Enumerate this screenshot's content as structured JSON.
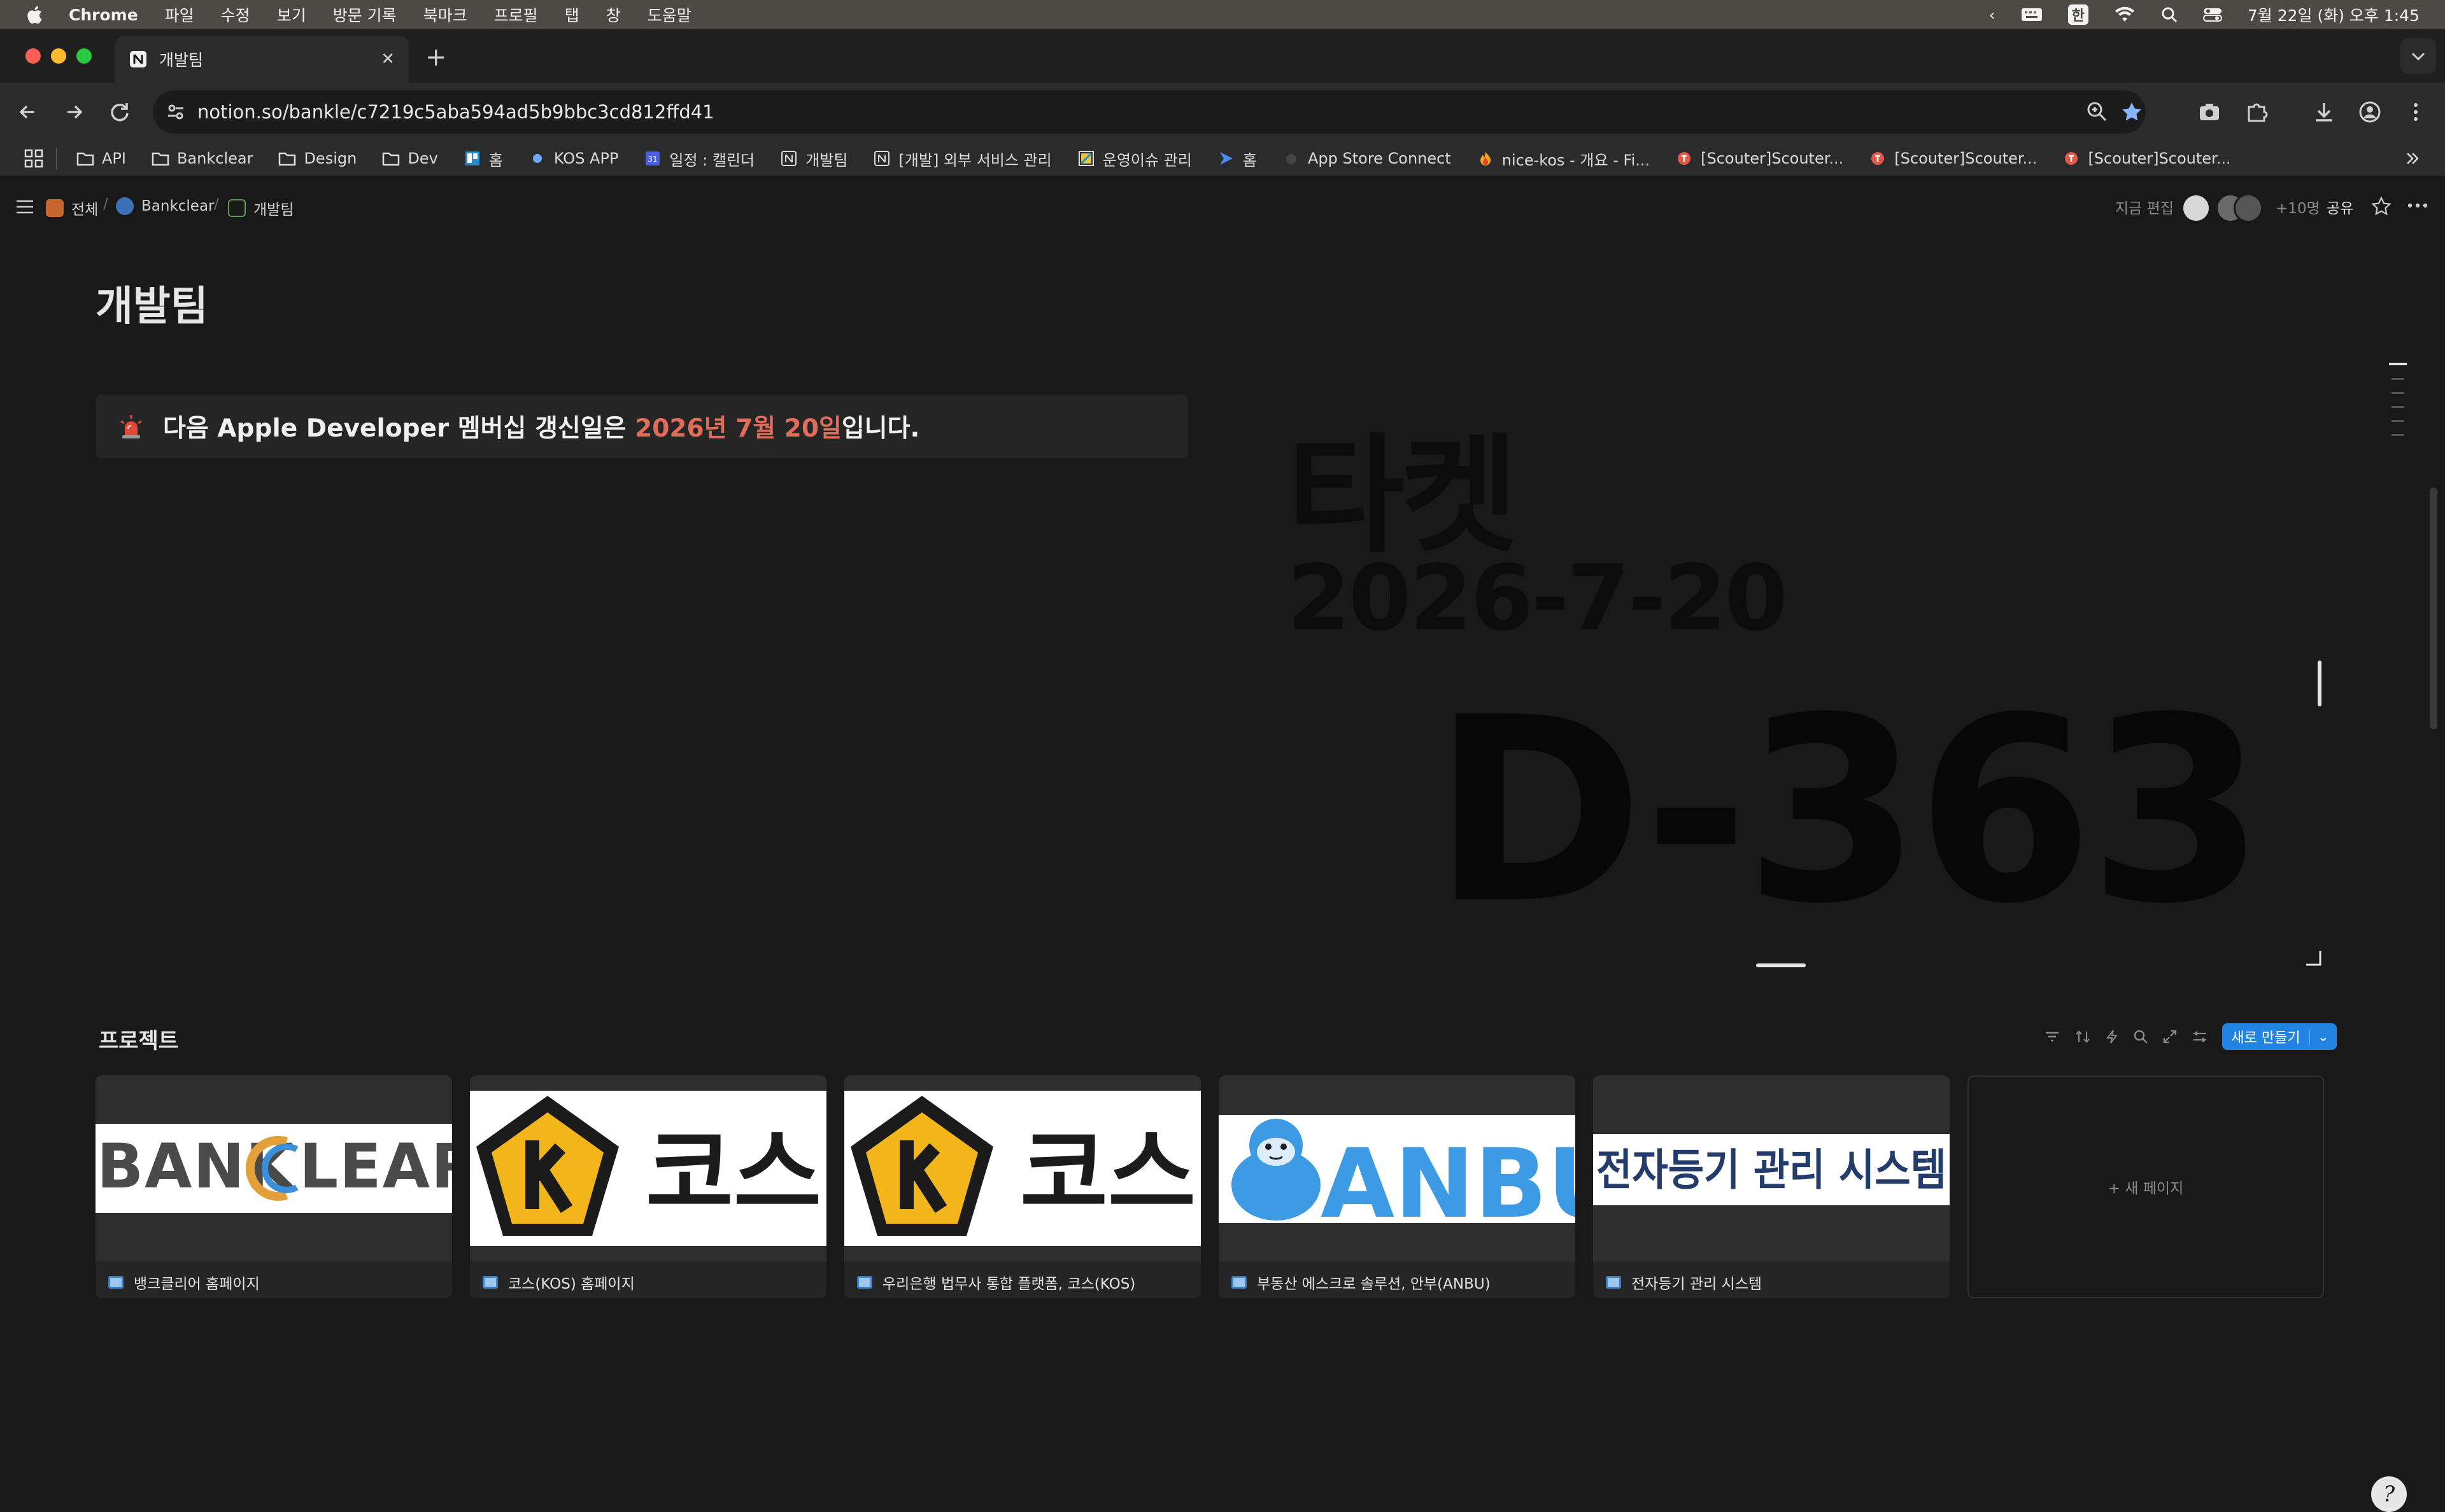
{
  "menubar": {
    "app": "Chrome",
    "items": [
      "파일",
      "수정",
      "보기",
      "방문 기록",
      "북마크",
      "프로필",
      "탭",
      "창",
      "도움말"
    ],
    "ime": "한",
    "clock": "7월 22일 (화) 오후 1:45"
  },
  "tab": {
    "title": "개발팀"
  },
  "omnibox": {
    "url": "notion.so/bankle/c7219c5aba594ad5b9bbc3cd812ffd41"
  },
  "bookmarks": [
    {
      "label": "API",
      "icon": "folder-icon"
    },
    {
      "label": "Bankclear",
      "icon": "folder-icon"
    },
    {
      "label": "Design",
      "icon": "folder-icon"
    },
    {
      "label": "Dev",
      "icon": "folder-icon"
    },
    {
      "label": "홈",
      "icon": "board-icon"
    },
    {
      "label": "KOS APP",
      "icon": "circle-icon"
    },
    {
      "label": "일정 : 캘린더",
      "icon": "calendar-icon"
    },
    {
      "label": "개발팀",
      "icon": "notion-icon"
    },
    {
      "label": "[개발] 외부 서비스 관리",
      "icon": "notion-icon"
    },
    {
      "label": "운영이슈 관리",
      "icon": "page-icon"
    },
    {
      "label": "홈",
      "icon": "flag-icon"
    },
    {
      "label": "App Store Connect",
      "icon": "apple-icon"
    },
    {
      "label": "nice-kos - 개요 - Fi...",
      "icon": "fire-icon"
    },
    {
      "label": "[Scouter]Scouter...",
      "icon": "scouter-icon"
    },
    {
      "label": "[Scouter]Scouter...",
      "icon": "scouter-icon"
    },
    {
      "label": "[Scouter]Scouter...",
      "icon": "scouter-icon"
    }
  ],
  "notion": {
    "breadcrumb": [
      "전체",
      "Bankclear",
      "개발팀"
    ],
    "topbar": {
      "editing": "지금 편집",
      "more_users": "+10명",
      "share": "공유"
    },
    "page_title": "개발팀",
    "callout": {
      "prefix": "다음 Apple Developer 멤버십 갱신일은 ",
      "highlight": "2026년 7월 20일",
      "suffix": "입니다."
    },
    "embed": {
      "title": "타켓",
      "date": "2026-7-20",
      "dday": "D-363"
    },
    "projects": {
      "title": "프로젝트",
      "new_button": "새로 만들기",
      "new_page": "+ 새 페이지",
      "cards": [
        {
          "caption": "뱅크클리어 홈페이지",
          "logo_text": "BANKCLEAR"
        },
        {
          "caption": "코스(KOS) 홈페이지",
          "logo_text": "코스"
        },
        {
          "caption": "우리은행 법무사 통합 플랫폼, 코스(KOS)",
          "logo_text": "코스"
        },
        {
          "caption": "부동산 에스크로 솔루션, 안부(ANBU)",
          "logo_text": "ANBU"
        },
        {
          "caption": "전자등기 관리 시스템",
          "logo_text": "전자등기 관리 시스템"
        }
      ]
    }
  },
  "colors": {
    "highlight": "#e06c5a",
    "accent": "#2383e2",
    "background": "#191919"
  }
}
